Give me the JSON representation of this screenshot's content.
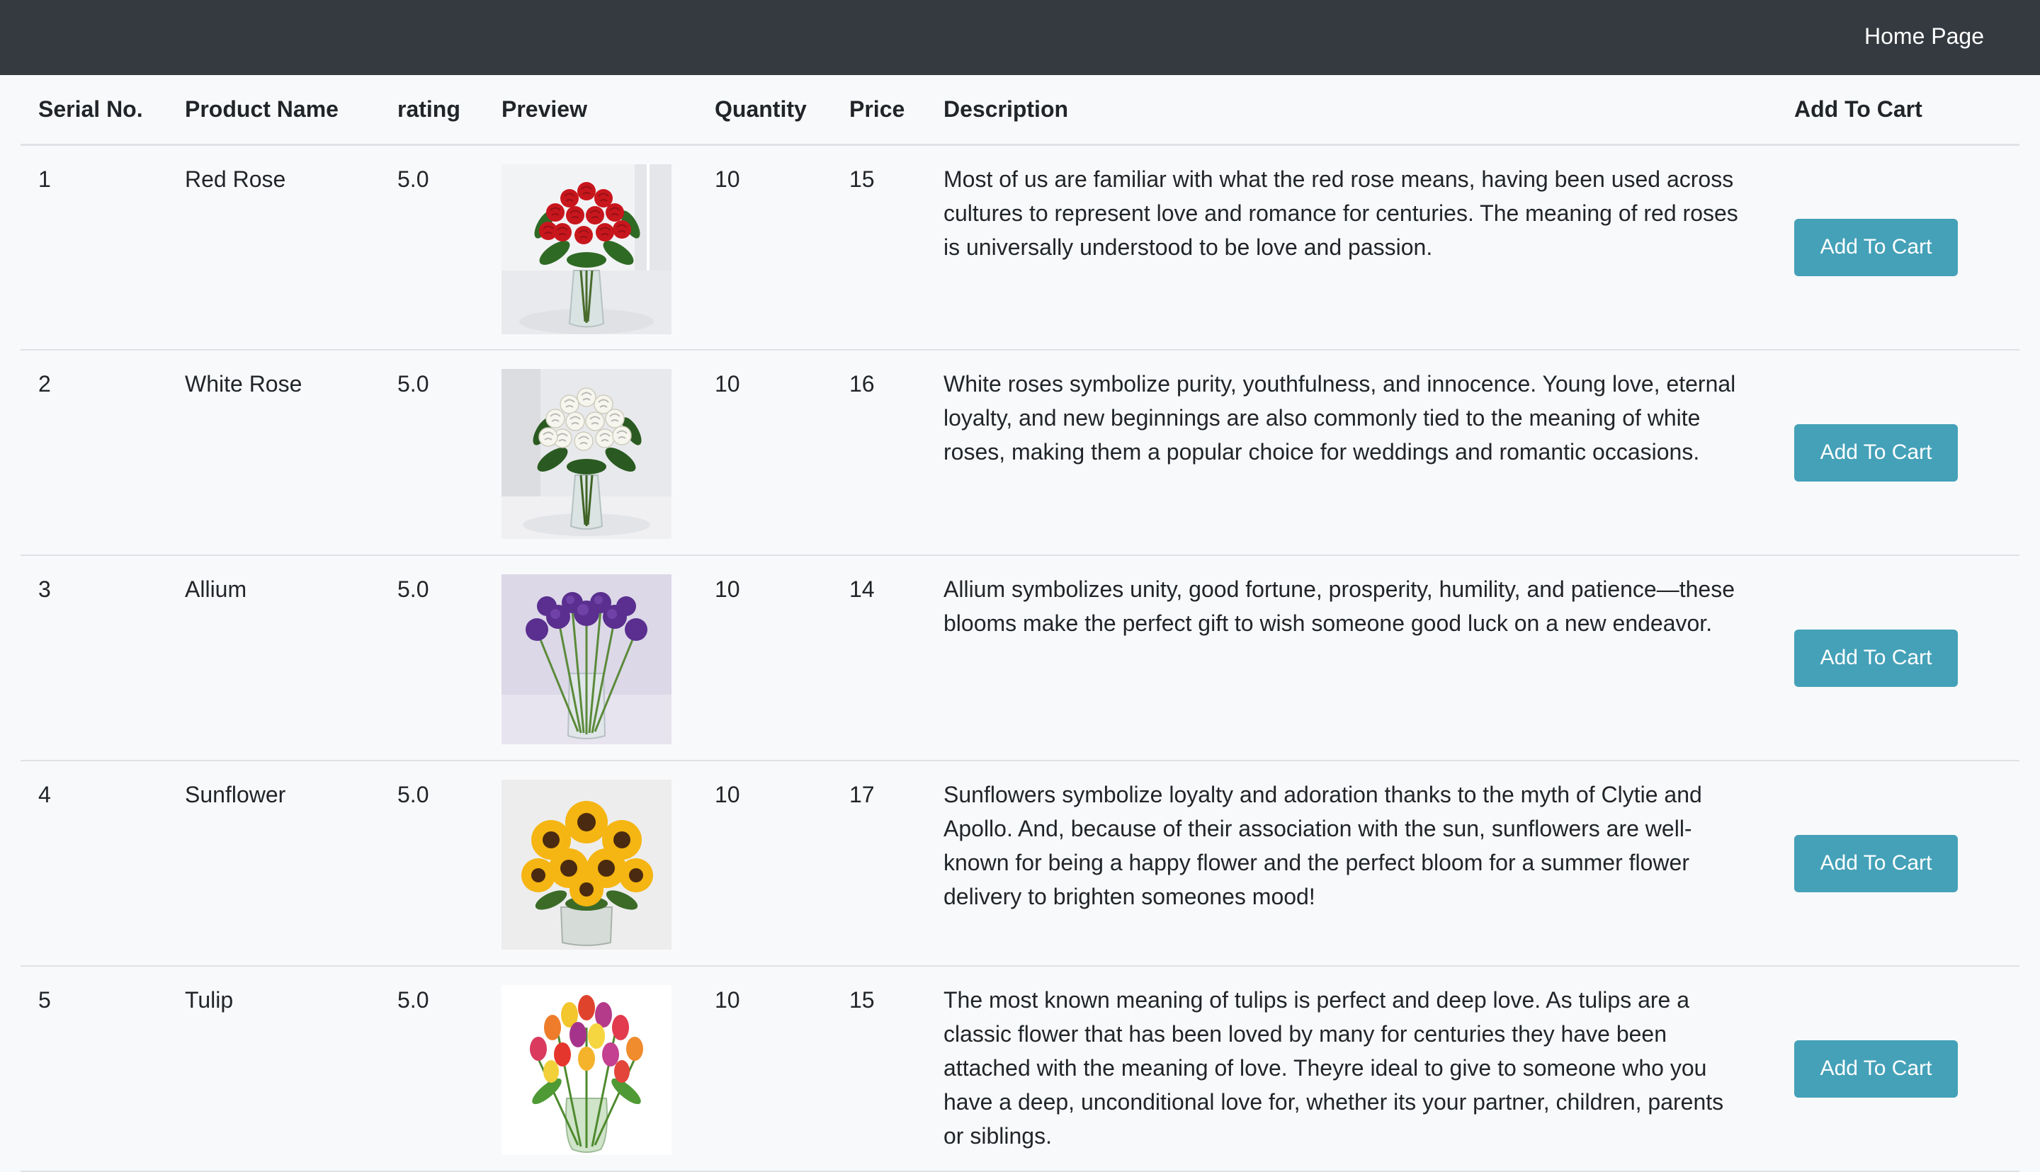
{
  "navbar": {
    "home_link": "Home Page"
  },
  "table": {
    "headers": [
      "Serial No.",
      "Product Name",
      "rating",
      "Preview",
      "Quantity",
      "Price",
      "Description",
      "Add To Cart"
    ],
    "rows": [
      {
        "serial": "1",
        "name": "Red Rose",
        "rating": "5.0",
        "image": "red-rose-bouquet",
        "quantity": "10",
        "price": "15",
        "description": "Most of us are familiar with what the red rose means, having been used across cultures to represent love and romance for centuries. The meaning of red roses is universally understood to be love and passion.",
        "button": "Add To Cart"
      },
      {
        "serial": "2",
        "name": "White Rose",
        "rating": "5.0",
        "image": "white-rose-bouquet",
        "quantity": "10",
        "price": "16",
        "description": "White roses symbolize purity, youthfulness, and innocence. Young love, eternal loyalty, and new beginnings are also commonly tied to the meaning of white roses, making them a popular choice for weddings and romantic occasions.",
        "button": "Add To Cart"
      },
      {
        "serial": "3",
        "name": "Allium",
        "rating": "5.0",
        "image": "allium-bouquet",
        "quantity": "10",
        "price": "14",
        "description": "Allium symbolizes unity, good fortune, prosperity, humility, and patience—these blooms make the perfect gift to wish someone good luck on a new endeavor.",
        "button": "Add To Cart"
      },
      {
        "serial": "4",
        "name": "Sunflower",
        "rating": "5.0",
        "image": "sunflower-bouquet",
        "quantity": "10",
        "price": "17",
        "description": "Sunflowers symbolize loyalty and adoration thanks to the myth of Clytie and Apollo. And, because of their association with the sun, sunflowers are well-known for being a happy flower and the perfect bloom for a summer flower delivery to brighten someones mood!",
        "button": "Add To Cart"
      },
      {
        "serial": "5",
        "name": "Tulip",
        "rating": "5.0",
        "image": "tulip-bouquet",
        "quantity": "10",
        "price": "15",
        "description": "The most known meaning of tulips is perfect and deep love. As tulips are a classic flower that has been loved by many for centuries they have been attached with the meaning of love. Theyre ideal to give to someone who you have a deep, unconditional love for, whether its your partner, children, parents or siblings.",
        "button": "Add To Cart"
      }
    ]
  },
  "colors": {
    "navbar": "#343a40",
    "page_background": "#f8f9fa",
    "button": "#44a1b8",
    "button_text": "#ffffff"
  }
}
